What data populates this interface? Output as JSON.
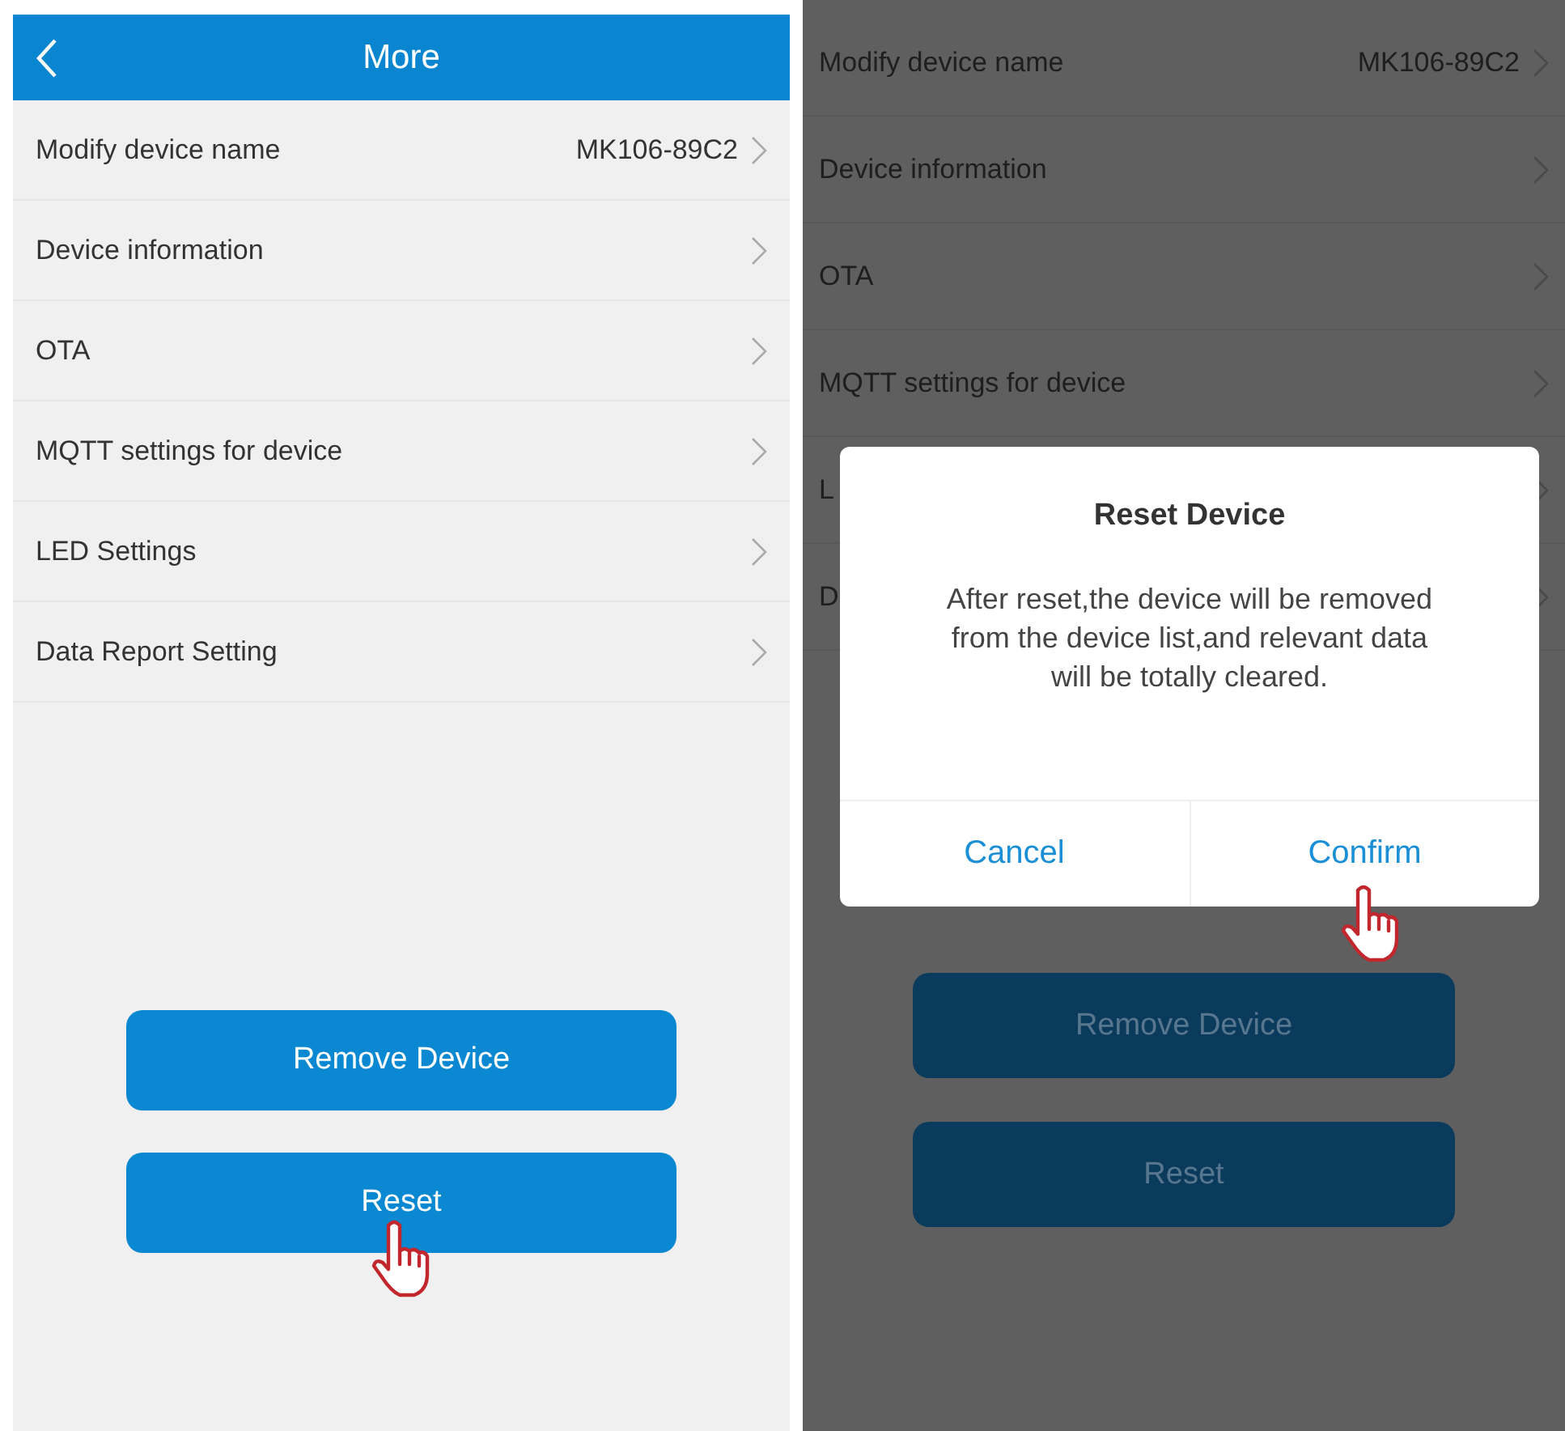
{
  "screens": [
    {
      "dimmed": false,
      "header": {
        "title": "More"
      },
      "rows": [
        {
          "label": "Modify device name",
          "value": "MK106-89C2"
        },
        {
          "label": "Device information"
        },
        {
          "label": "OTA"
        },
        {
          "label": "MQTT settings for device"
        },
        {
          "label": "LED Settings"
        },
        {
          "label": "Data Report Setting"
        }
      ],
      "buttons": [
        {
          "label": "Remove Device",
          "pointer": false
        },
        {
          "label": "Reset",
          "pointer": true
        }
      ]
    },
    {
      "dimmed": true,
      "rows": [
        {
          "label": "Modify device name",
          "value": "MK106-89C2"
        },
        {
          "label": "Device information"
        },
        {
          "label": "OTA"
        },
        {
          "label": "MQTT settings for device"
        },
        {
          "label": "L"
        },
        {
          "label": "D"
        }
      ],
      "buttons": [
        {
          "label": "Remove Device",
          "pointer": false
        },
        {
          "label": "Reset",
          "pointer": false
        }
      ],
      "dialog": {
        "title": "Reset Device",
        "message": "After reset,the device will be removed from the device list,and relevant data will be totally cleared.",
        "actions": [
          {
            "label": "Cancel",
            "pointer": false
          },
          {
            "label": "Confirm",
            "pointer": true
          }
        ]
      }
    }
  ]
}
